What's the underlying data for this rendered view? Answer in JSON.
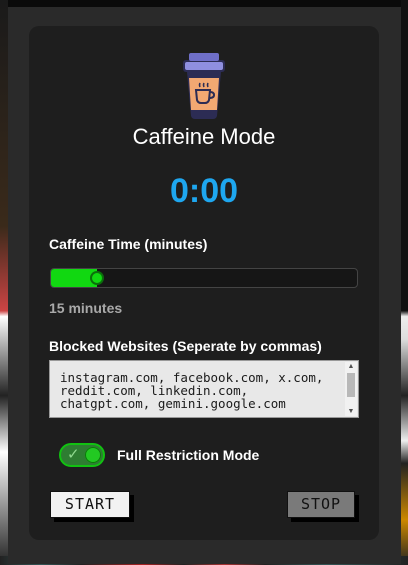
{
  "app": {
    "title": "Caffeine Mode",
    "timer": "0:00"
  },
  "caffeine_time": {
    "label": "Caffeine Time (minutes)",
    "value_fraction": 0.15,
    "value_text": "15 minutes"
  },
  "blocked_websites": {
    "label": "Blocked Websites (Seperate by commas)",
    "value": "instagram.com, facebook.com, x.com, reddit.com, linkedin.com, chatgpt.com, gemini.google.com"
  },
  "restriction": {
    "label": "Full Restriction Mode",
    "enabled": true
  },
  "buttons": {
    "start": "START",
    "stop": "STOP"
  },
  "colors": {
    "accent_blue": "#1ea7f0",
    "slider_green": "#11d811",
    "panel": "#1e1e1e"
  },
  "icons": {
    "logo": "coffee-cup-icon"
  }
}
